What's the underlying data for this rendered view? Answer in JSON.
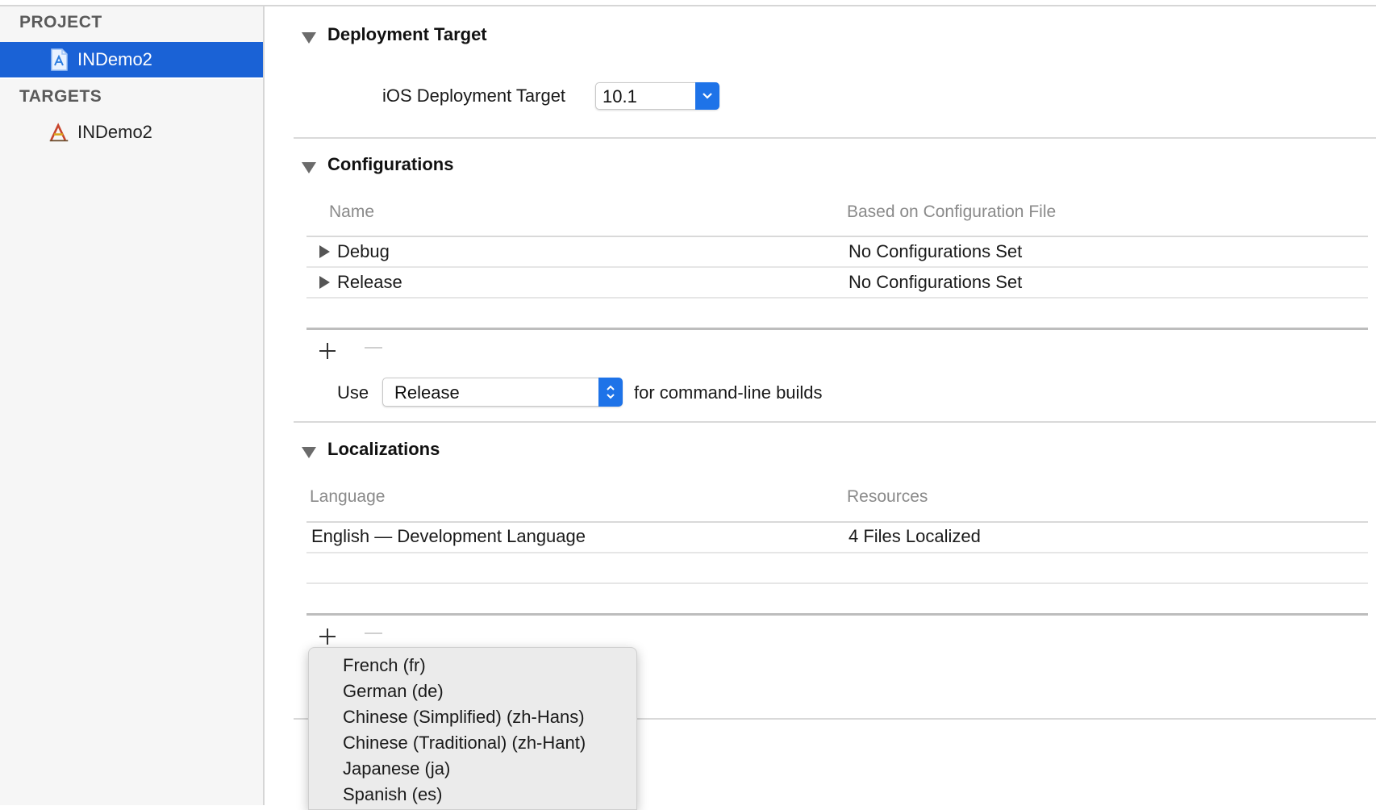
{
  "sidebar": {
    "project_header": "PROJECT",
    "project_item": "INDemo2",
    "targets_header": "TARGETS",
    "target_item": "INDemo2"
  },
  "deployment": {
    "title": "Deployment Target",
    "ios_label": "iOS Deployment Target",
    "ios_value": "10.1"
  },
  "configurations": {
    "title": "Configurations",
    "columns": [
      "Name",
      "Based on Configuration File"
    ],
    "rows": [
      {
        "name": "Debug",
        "file": "No Configurations Set"
      },
      {
        "name": "Release",
        "file": "No Configurations Set"
      }
    ],
    "use_label": "Use",
    "use_value": "Release",
    "use_suffix": "for command-line builds"
  },
  "localizations": {
    "title": "Localizations",
    "columns": [
      "Language",
      "Resources"
    ],
    "rows": [
      {
        "language": "English — Development Language",
        "resources": "4 Files Localized"
      }
    ]
  },
  "language_menu": {
    "items": [
      "French (fr)",
      "German (de)",
      "Chinese (Simplified) (zh-Hans)",
      "Chinese (Traditional) (zh-Hant)",
      "Japanese (ja)",
      "Spanish (es)"
    ]
  },
  "colors": {
    "selection": "#1a62d6",
    "popup_accent": "#1e73e8"
  }
}
